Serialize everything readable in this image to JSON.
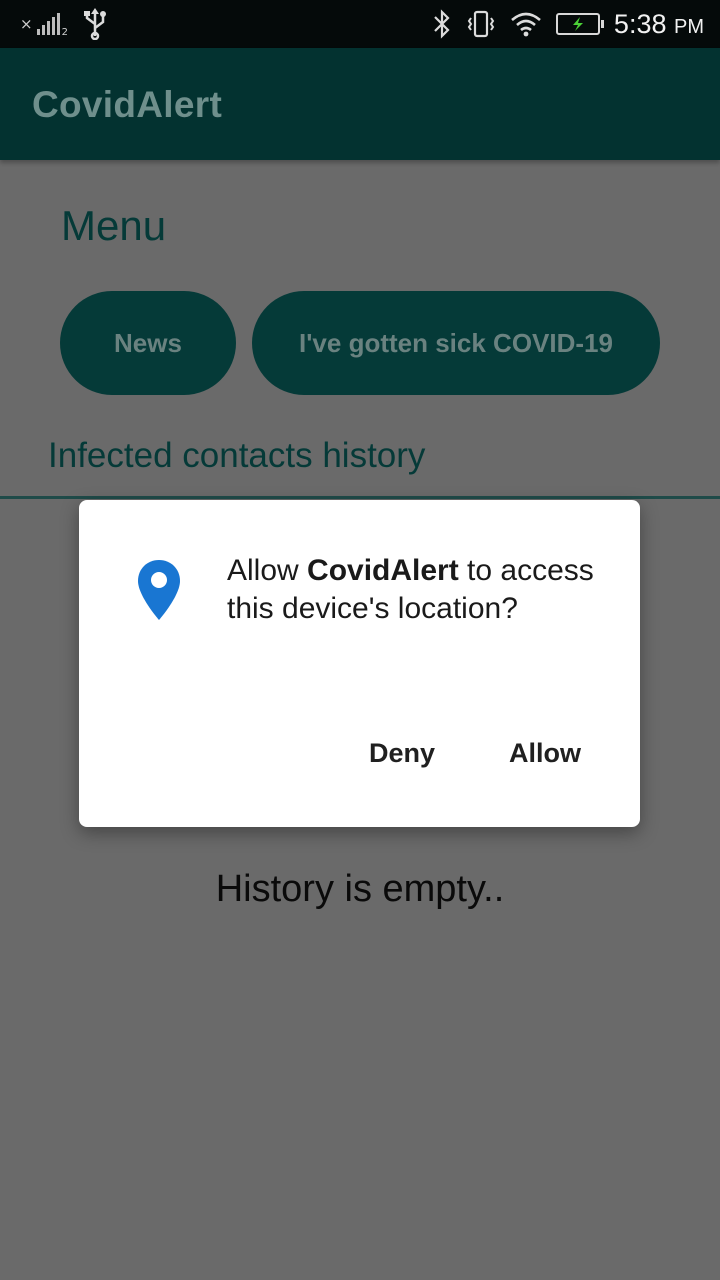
{
  "status_bar": {
    "time": "5:38",
    "ampm": "PM",
    "sim_slot": "2",
    "no_signal_mark": "×",
    "icons": [
      "signal-icon",
      "usb-icon",
      "bluetooth-icon",
      "vibrate-icon",
      "wifi-icon",
      "battery-charging-icon"
    ]
  },
  "app_bar": {
    "title": "CovidAlert"
  },
  "main": {
    "menu_heading": "Menu",
    "buttons": {
      "news": "News",
      "sick": "I've gotten sick COVID-19"
    },
    "history_title": "Infected contacts history",
    "empty_text": "History is empty.."
  },
  "dialog": {
    "message_prefix": "Allow ",
    "app_name": "CovidAlert",
    "message_suffix": " to access this device's location?",
    "deny_label": "Deny",
    "allow_label": "Allow",
    "icon": "location-pin-icon",
    "icon_color": "#1976d2"
  },
  "colors": {
    "app_bar": "#033230",
    "accent": "#053a38",
    "scrim_background": "#6a6a6a"
  }
}
